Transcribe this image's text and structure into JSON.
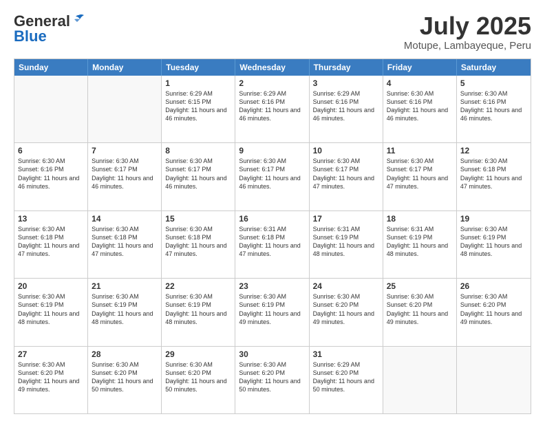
{
  "header": {
    "logo": {
      "line1": "General",
      "line2": "Blue"
    },
    "title": "July 2025",
    "location": "Motupe, Lambayeque, Peru"
  },
  "days_of_week": [
    "Sunday",
    "Monday",
    "Tuesday",
    "Wednesday",
    "Thursday",
    "Friday",
    "Saturday"
  ],
  "weeks": [
    [
      {
        "day": "",
        "info": ""
      },
      {
        "day": "",
        "info": ""
      },
      {
        "day": "1",
        "sunrise": "6:29 AM",
        "sunset": "6:15 PM",
        "daylight": "11 hours and 46 minutes."
      },
      {
        "day": "2",
        "sunrise": "6:29 AM",
        "sunset": "6:16 PM",
        "daylight": "11 hours and 46 minutes."
      },
      {
        "day": "3",
        "sunrise": "6:29 AM",
        "sunset": "6:16 PM",
        "daylight": "11 hours and 46 minutes."
      },
      {
        "day": "4",
        "sunrise": "6:30 AM",
        "sunset": "6:16 PM",
        "daylight": "11 hours and 46 minutes."
      },
      {
        "day": "5",
        "sunrise": "6:30 AM",
        "sunset": "6:16 PM",
        "daylight": "11 hours and 46 minutes."
      }
    ],
    [
      {
        "day": "6",
        "sunrise": "6:30 AM",
        "sunset": "6:16 PM",
        "daylight": "11 hours and 46 minutes."
      },
      {
        "day": "7",
        "sunrise": "6:30 AM",
        "sunset": "6:17 PM",
        "daylight": "11 hours and 46 minutes."
      },
      {
        "day": "8",
        "sunrise": "6:30 AM",
        "sunset": "6:17 PM",
        "daylight": "11 hours and 46 minutes."
      },
      {
        "day": "9",
        "sunrise": "6:30 AM",
        "sunset": "6:17 PM",
        "daylight": "11 hours and 46 minutes."
      },
      {
        "day": "10",
        "sunrise": "6:30 AM",
        "sunset": "6:17 PM",
        "daylight": "11 hours and 47 minutes."
      },
      {
        "day": "11",
        "sunrise": "6:30 AM",
        "sunset": "6:17 PM",
        "daylight": "11 hours and 47 minutes."
      },
      {
        "day": "12",
        "sunrise": "6:30 AM",
        "sunset": "6:18 PM",
        "daylight": "11 hours and 47 minutes."
      }
    ],
    [
      {
        "day": "13",
        "sunrise": "6:30 AM",
        "sunset": "6:18 PM",
        "daylight": "11 hours and 47 minutes."
      },
      {
        "day": "14",
        "sunrise": "6:30 AM",
        "sunset": "6:18 PM",
        "daylight": "11 hours and 47 minutes."
      },
      {
        "day": "15",
        "sunrise": "6:30 AM",
        "sunset": "6:18 PM",
        "daylight": "11 hours and 47 minutes."
      },
      {
        "day": "16",
        "sunrise": "6:31 AM",
        "sunset": "6:18 PM",
        "daylight": "11 hours and 47 minutes."
      },
      {
        "day": "17",
        "sunrise": "6:31 AM",
        "sunset": "6:19 PM",
        "daylight": "11 hours and 48 minutes."
      },
      {
        "day": "18",
        "sunrise": "6:31 AM",
        "sunset": "6:19 PM",
        "daylight": "11 hours and 48 minutes."
      },
      {
        "day": "19",
        "sunrise": "6:30 AM",
        "sunset": "6:19 PM",
        "daylight": "11 hours and 48 minutes."
      }
    ],
    [
      {
        "day": "20",
        "sunrise": "6:30 AM",
        "sunset": "6:19 PM",
        "daylight": "11 hours and 48 minutes."
      },
      {
        "day": "21",
        "sunrise": "6:30 AM",
        "sunset": "6:19 PM",
        "daylight": "11 hours and 48 minutes."
      },
      {
        "day": "22",
        "sunrise": "6:30 AM",
        "sunset": "6:19 PM",
        "daylight": "11 hours and 48 minutes."
      },
      {
        "day": "23",
        "sunrise": "6:30 AM",
        "sunset": "6:19 PM",
        "daylight": "11 hours and 49 minutes."
      },
      {
        "day": "24",
        "sunrise": "6:30 AM",
        "sunset": "6:20 PM",
        "daylight": "11 hours and 49 minutes."
      },
      {
        "day": "25",
        "sunrise": "6:30 AM",
        "sunset": "6:20 PM",
        "daylight": "11 hours and 49 minutes."
      },
      {
        "day": "26",
        "sunrise": "6:30 AM",
        "sunset": "6:20 PM",
        "daylight": "11 hours and 49 minutes."
      }
    ],
    [
      {
        "day": "27",
        "sunrise": "6:30 AM",
        "sunset": "6:20 PM",
        "daylight": "11 hours and 49 minutes."
      },
      {
        "day": "28",
        "sunrise": "6:30 AM",
        "sunset": "6:20 PM",
        "daylight": "11 hours and 50 minutes."
      },
      {
        "day": "29",
        "sunrise": "6:30 AM",
        "sunset": "6:20 PM",
        "daylight": "11 hours and 50 minutes."
      },
      {
        "day": "30",
        "sunrise": "6:30 AM",
        "sunset": "6:20 PM",
        "daylight": "11 hours and 50 minutes."
      },
      {
        "day": "31",
        "sunrise": "6:29 AM",
        "sunset": "6:20 PM",
        "daylight": "11 hours and 50 minutes."
      },
      {
        "day": "",
        "info": ""
      },
      {
        "day": "",
        "info": ""
      }
    ]
  ]
}
